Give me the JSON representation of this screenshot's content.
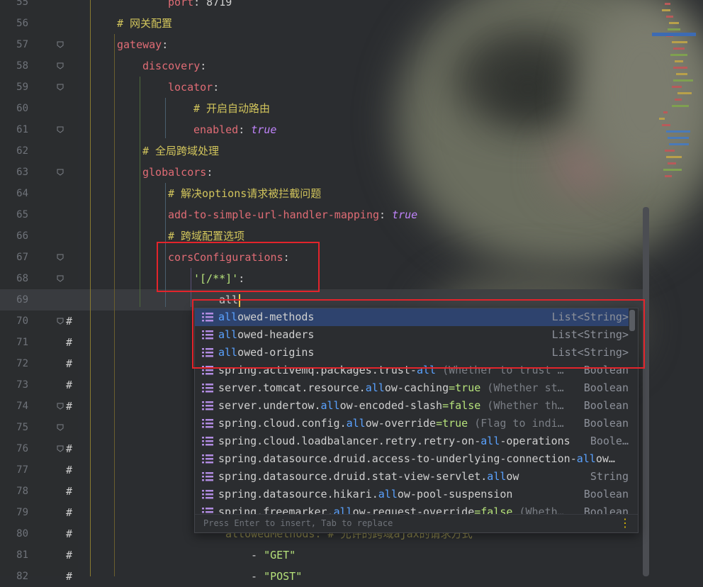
{
  "editor": {
    "lines": [
      {
        "num": "55",
        "parts": [
          [
            "k",
            "port"
          ],
          [
            "p",
            ": 8719"
          ]
        ]
      },
      {
        "num": "56",
        "parts": [
          [
            "c",
            "# 网关配置"
          ]
        ]
      },
      {
        "num": "57",
        "parts": [
          [
            "k",
            "gateway"
          ],
          [
            "p",
            ":"
          ]
        ]
      },
      {
        "num": "58",
        "parts": [
          [
            "k",
            "discovery"
          ],
          [
            "p",
            ":"
          ]
        ]
      },
      {
        "num": "59",
        "parts": [
          [
            "k",
            "locator"
          ],
          [
            "p",
            ":"
          ]
        ]
      },
      {
        "num": "60",
        "parts": [
          [
            "c",
            "# 开启自动路由"
          ]
        ]
      },
      {
        "num": "61",
        "parts": [
          [
            "k",
            "enabled"
          ],
          [
            "p",
            ": "
          ],
          [
            "b",
            "true"
          ]
        ]
      },
      {
        "num": "62",
        "parts": [
          [
            "c",
            "# 全局跨域处理"
          ]
        ]
      },
      {
        "num": "63",
        "parts": [
          [
            "k",
            "globalcors"
          ],
          [
            "p",
            ":"
          ]
        ]
      },
      {
        "num": "64",
        "parts": [
          [
            "c",
            "# 解决options请求被拦截问题"
          ]
        ]
      },
      {
        "num": "65",
        "parts": [
          [
            "k",
            "add-to-simple-url-handler-mapping"
          ],
          [
            "p",
            ": "
          ],
          [
            "b",
            "true"
          ]
        ]
      },
      {
        "num": "66",
        "parts": [
          [
            "c",
            "# 跨域配置选项"
          ]
        ]
      },
      {
        "num": "67",
        "parts": [
          [
            "k",
            "corsConfigurations"
          ],
          [
            "p",
            ":"
          ]
        ]
      },
      {
        "num": "68",
        "parts": [
          [
            "s",
            "'[/**]'"
          ],
          [
            "p",
            ":"
          ]
        ]
      },
      {
        "num": "69",
        "parts": [
          [
            "p",
            "all"
          ]
        ]
      },
      {
        "num": "70",
        "parts": []
      },
      {
        "num": "71",
        "parts": []
      },
      {
        "num": "72",
        "parts": []
      },
      {
        "num": "73",
        "parts": []
      },
      {
        "num": "74",
        "parts": []
      },
      {
        "num": "75",
        "parts": []
      },
      {
        "num": "76",
        "parts": []
      },
      {
        "num": "77",
        "parts": []
      },
      {
        "num": "78",
        "parts": []
      },
      {
        "num": "79",
        "parts": []
      },
      {
        "num": "80",
        "parts": [
          [
            "c",
            "allowedMethods: # 允许的跨域ajax的请求方式"
          ]
        ]
      },
      {
        "num": "81",
        "parts": [
          [
            "p",
            "- "
          ],
          [
            "s",
            "\"GET\""
          ]
        ]
      },
      {
        "num": "82",
        "parts": [
          [
            "p",
            "- "
          ],
          [
            "s",
            "\"POST\""
          ]
        ]
      }
    ],
    "gutter_hash": "#"
  },
  "completion": {
    "typed": "all",
    "items": [
      {
        "pre": "",
        "hl": "all",
        "rest": "owed-methods",
        "val": "",
        "desc": "",
        "type": "List<String>"
      },
      {
        "pre": "",
        "hl": "all",
        "rest": "owed-headers",
        "val": "",
        "desc": "",
        "type": "List<String>"
      },
      {
        "pre": "",
        "hl": "all",
        "rest": "owed-origins",
        "val": "",
        "desc": "",
        "type": "List<String>"
      },
      {
        "pre": "spring.activemq.packages.trust-",
        "hl": "all",
        "rest": "",
        "val": "",
        "desc": " (Whether to trust …",
        "type": "Boolean"
      },
      {
        "pre": "server.tomcat.resource.",
        "hl": "all",
        "rest": "ow-caching",
        "val": "=true",
        "desc": " (Whether st…",
        "type": "Boolean"
      },
      {
        "pre": "server.undertow.",
        "hl": "all",
        "rest": "ow-encoded-slash",
        "val": "=false",
        "desc": " (Whether th…",
        "type": "Boolean"
      },
      {
        "pre": "spring.cloud.config.",
        "hl": "all",
        "rest": "ow-override",
        "val": "=true",
        "desc": " (Flag to indi…",
        "type": "Boolean"
      },
      {
        "pre": "spring.cloud.loadbalancer.retry.retry-on-",
        "hl": "all",
        "rest": "-operations",
        "val": "",
        "desc": "",
        "type": "Boole…"
      },
      {
        "pre": "spring.datasource.druid.access-to-underlying-connection-",
        "hl": "all",
        "rest": "ow…",
        "val": "",
        "desc": "",
        "type": ""
      },
      {
        "pre": "spring.datasource.druid.stat-view-servlet.",
        "hl": "all",
        "rest": "ow",
        "val": "",
        "desc": "",
        "type": "String"
      },
      {
        "pre": "spring.datasource.hikari.",
        "hl": "all",
        "rest": "ow-pool-suspension",
        "val": "",
        "desc": "",
        "type": "Boolean"
      },
      {
        "pre": "spring.freemarker.",
        "hl": "all",
        "rest": "ow-request-override",
        "val": "=false",
        "desc": " (Wheth…",
        "type": "Boolean"
      }
    ],
    "footer_hint": "Press Enter to insert, Tab to replace",
    "more_icon": "vertical-ellipsis-icon"
  },
  "colors": {
    "key": "#e06c75",
    "comment": "#d2c55c",
    "boolean": "#c084fc",
    "string": "#b6e27a",
    "match": "#5aa2ff",
    "selection": "#2e436e",
    "annotation": "#e3242b"
  }
}
